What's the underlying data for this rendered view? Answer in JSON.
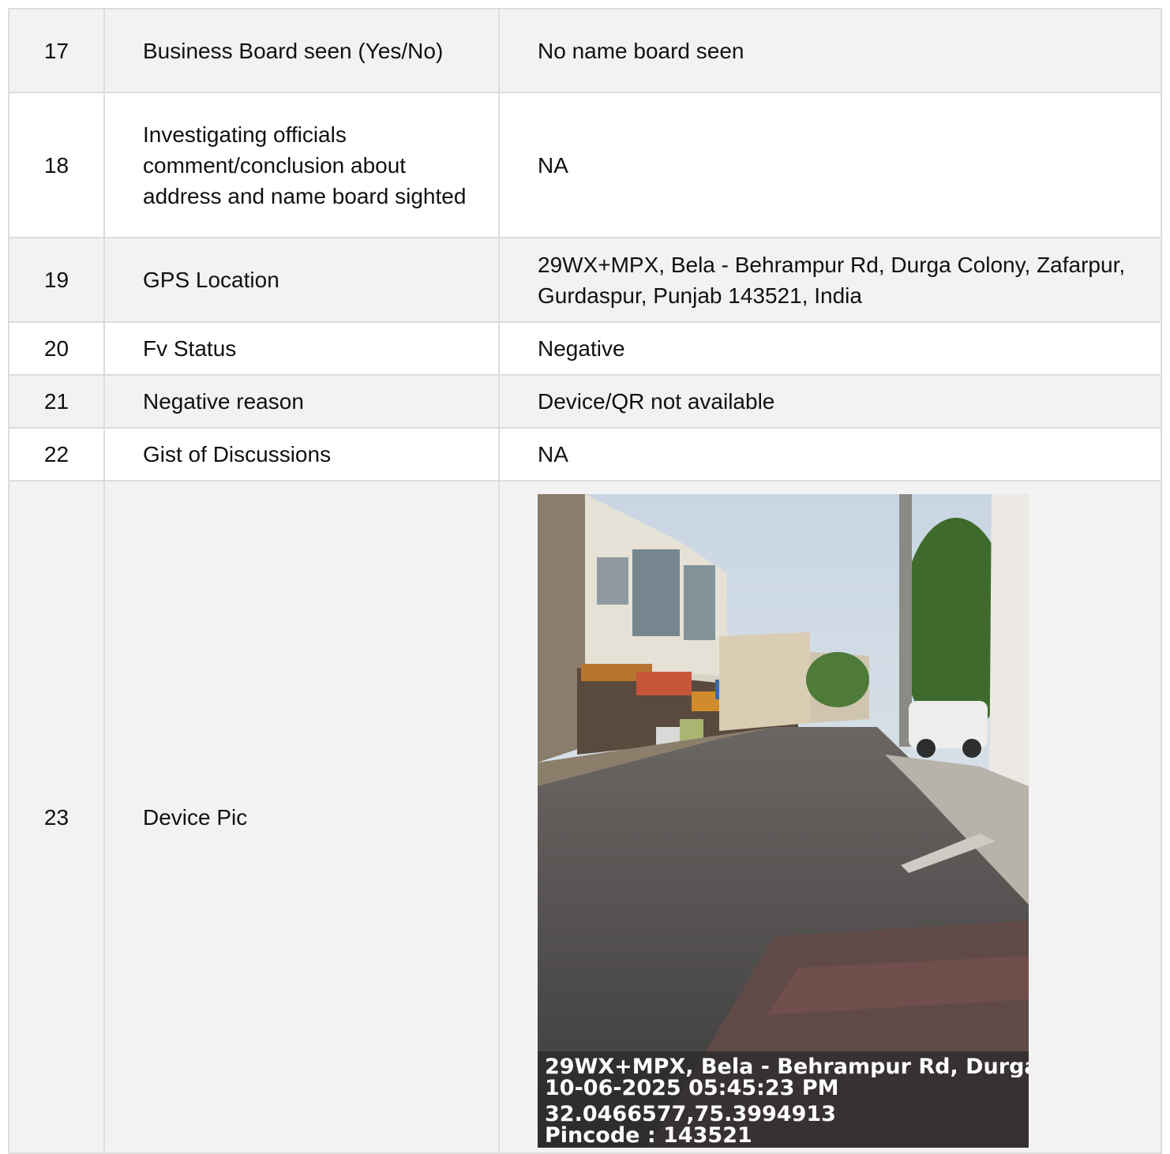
{
  "rows": [
    {
      "num": "17",
      "label": "Business Board seen (Yes/No)",
      "value": "No name board seen"
    },
    {
      "num": "18",
      "label": "Investigating officials comment/conclusion about address and name board sighted",
      "value": "NA"
    },
    {
      "num": "19",
      "label": "GPS Location",
      "value": "29WX+MPX, Bela - Behrampur Rd, Durga Colony, Zafarpur, Gurdaspur, Punjab 143521, India"
    },
    {
      "num": "20",
      "label": "Fv Status",
      "value": "Negative"
    },
    {
      "num": "21",
      "label": "Negative reason",
      "value": "Device/QR not available"
    },
    {
      "num": "22",
      "label": "Gist of Discussions",
      "value": "NA"
    },
    {
      "num": "23",
      "label": "Device Pic",
      "value": ""
    }
  ],
  "device_photo": {
    "caption_address": "29WX+MPX, Bela - Behrampur Rd, Durga ...",
    "caption_datetime": "10-06-2025 05:45:23 PM",
    "caption_coords": "32.0466577,75.3994913",
    "caption_pincode": "Pincode : 143521"
  }
}
